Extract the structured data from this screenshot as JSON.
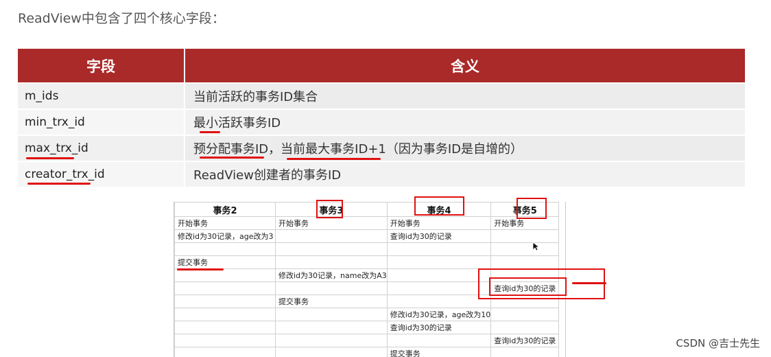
{
  "intro": "ReadView中包含了四个核心字段：",
  "fields_table": {
    "headers": [
      "字段",
      "含义"
    ],
    "rows": [
      {
        "field": "m_ids",
        "meaning": "当前活跃的事务ID集合"
      },
      {
        "field": "min_trx_id",
        "meaning": "最小活跃事务ID"
      },
      {
        "field": "max_trx_id",
        "meaning": "预分配事务ID，当前最大事务ID+1（因为事务ID是自增的）"
      },
      {
        "field": "creator_trx_id",
        "meaning": "ReadView创建者的事务ID"
      }
    ]
  },
  "tx_table": {
    "headers": [
      "事务2",
      "事务3",
      "事务4",
      "事务5"
    ],
    "rows": [
      [
        "开始事务",
        "开始事务",
        "开始事务",
        "开始事务"
      ],
      [
        "修改id为30记录，age改为3",
        "",
        "查询id为30的记录",
        ""
      ],
      [
        "",
        "",
        "",
        ""
      ],
      [
        "提交事务",
        "",
        "",
        ""
      ],
      [
        "",
        "修改id为30记录，name改为A3",
        "",
        ""
      ],
      [
        "",
        "",
        "",
        "查询id为30的记录"
      ],
      [
        "",
        "提交事务",
        "",
        ""
      ],
      [
        "",
        "",
        "修改id为30记录，age改为10",
        ""
      ],
      [
        "",
        "",
        "查询id为30的记录",
        ""
      ],
      [
        "",
        "",
        "",
        "查询id为30的记录"
      ],
      [
        "",
        "",
        "提交事务",
        ""
      ]
    ]
  },
  "annotation_color": "#e01010",
  "header_color": "#a92a29",
  "watermark": "CSDN @吉士先生"
}
